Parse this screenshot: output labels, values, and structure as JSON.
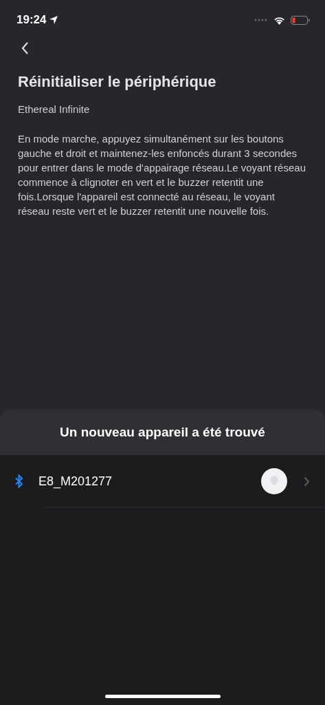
{
  "status_bar": {
    "time": "19:24"
  },
  "title": "Réinitialiser le périphérique",
  "subtitle": "Ethereal Infinite",
  "description": "En mode marche, appuyez simultanément sur les boutons gauche et droit et maintenez-les enfoncés durant 3 secondes pour entrer dans le mode d'appairage réseau.Le voyant réseau commence à clignoter en vert et le buzzer retentit une fois.Lorsque l'appareil est connecté au réseau, le voyant réseau reste vert et le buzzer retentit une nouvelle fois.",
  "sheet": {
    "title": "Un nouveau appareil a été trouvé",
    "devices": [
      {
        "name": "E8_M201277"
      }
    ]
  }
}
